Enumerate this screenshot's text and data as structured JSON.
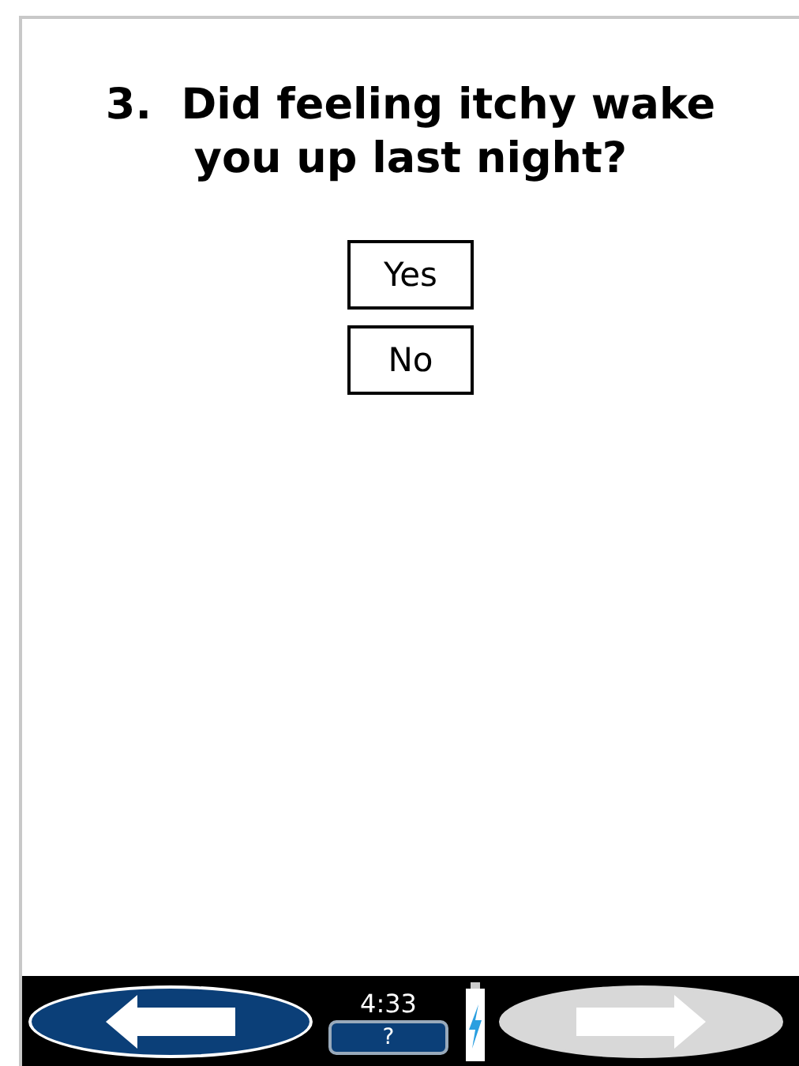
{
  "question": {
    "title": "3.  Did feeling itchy wake you up last night?"
  },
  "answers": [
    {
      "label": "Yes",
      "selected": false
    },
    {
      "label": "No",
      "selected": false
    }
  ],
  "nav": {
    "back": {
      "disabled": false
    },
    "next": {
      "disabled": true
    },
    "time": "4:33",
    "help": "?"
  }
}
